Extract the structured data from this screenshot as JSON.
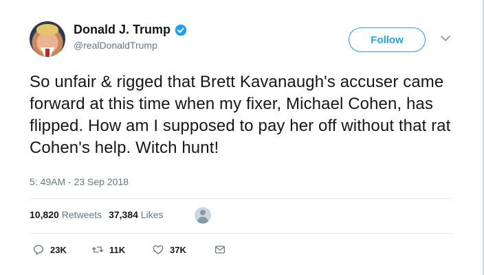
{
  "user": {
    "display_name": "Donald J. Trump",
    "handle": "@realDonaldTrump",
    "verified": true
  },
  "follow_label": "Follow",
  "tweet": {
    "text": "So unfair & rigged that Brett Kavanaugh's accuser came forward at this time when my fixer, Michael Cohen, has flipped. How am I supposed to pay her off without that rat Cohen's help. Witch hunt!",
    "timestamp": "5: 49AM - 23 Sep 2018"
  },
  "stats": {
    "retweets_count": "10,820",
    "retweets_label": "Retweets",
    "likes_count": "37,384",
    "likes_label": "Likes"
  },
  "actions": {
    "reply_count": "23K",
    "retweet_count": "11K",
    "like_count": "37K"
  },
  "colors": {
    "accent": "#1da1f2",
    "text": "#14171a",
    "muted": "#657786",
    "divider": "#e6ecf0"
  },
  "icons": [
    "verified-badge-icon",
    "chevron-down-icon",
    "reply-icon",
    "retweet-icon",
    "heart-icon",
    "envelope-icon"
  ]
}
